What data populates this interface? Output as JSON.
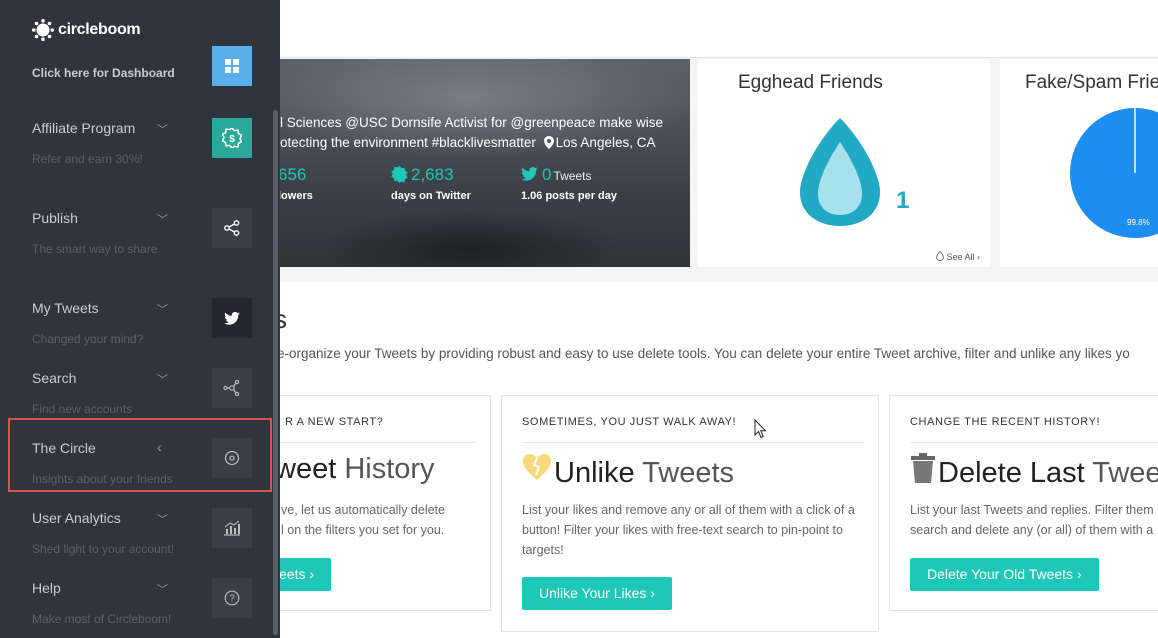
{
  "brand": {
    "name": "circleboom"
  },
  "sidebar": {
    "dashboard_label": "Click here for Dashboard",
    "items": [
      {
        "label": "Affiliate Program",
        "sub": "Refer and earn 30%!",
        "icon": "dollar-icon"
      },
      {
        "label": "Publish",
        "sub": "The smart way to share",
        "icon": "share-icon"
      },
      {
        "label": "My Tweets",
        "sub": "Changed your mind?",
        "icon": "twitter-icon"
      },
      {
        "label": "Search",
        "sub": "Find new accounts",
        "icon": "network-icon"
      },
      {
        "label": "The Circle",
        "sub": "Insights about your friends",
        "icon": "circle-icon"
      },
      {
        "label": "User Analytics",
        "sub": "Shed light to your account!",
        "icon": "chart-icon"
      },
      {
        "label": "Help",
        "sub": "Make most of Circleboom!",
        "icon": "question-icon"
      }
    ]
  },
  "profile": {
    "bio_line1": "l Sciences @USC Dornsife Activist for @greenpeace make wise",
    "bio_line2": "otecting the environment #blacklivesmatter",
    "location": "Los Angeles, CA",
    "stat_followers_value": "656",
    "stat_followers_label": "lowers",
    "stat_days_value": "2,683",
    "stat_days_label": "days on Twitter",
    "stat_tweets_value": "0",
    "stat_tweets_unit": "Tweets",
    "stat_tweets_label": "1.06 posts per day"
  },
  "egghead": {
    "title": "Egghead Friends",
    "count": "1",
    "see_all": "See All"
  },
  "fakespam": {
    "title": "Fake/Spam Frien",
    "percent": "99.8%"
  },
  "section": {
    "title": "s",
    "description": "e-organize your Tweets by providing robust and easy to use delete tools. You can delete your entire Tweet archive, filter and unlike any likes yo"
  },
  "cards": [
    {
      "kicker": "R A NEW START?",
      "title_bold": "weet",
      "title_light": "History",
      "desc_line1": "ve, let us automatically delete",
      "desc_line2": "l on the filters you set for you.",
      "button": "eets"
    },
    {
      "kicker": "SOMETIMES, YOU JUST WALK AWAY!",
      "title_bold": "Unlike",
      "title_light": "Tweets",
      "desc": "List your likes and remove any or all of them with a click of a button! Filter your likes with free-text search to pin-point to targets!",
      "button": "Unlike Your Likes"
    },
    {
      "kicker": "CHANGE THE RECENT HISTORY!",
      "title_bold": "Delete Last",
      "title_light": "Tweet",
      "desc_line1": "List your last Tweets and replies. Filter them",
      "desc_line2": "search and delete any (or all) of them with a",
      "button": "Delete Your Old Tweets"
    }
  ],
  "colors": {
    "accent": "#1ec7b7",
    "sidebar_bg": "#2f353d",
    "highlight": "#d9534f",
    "egg": "#22a9c4",
    "pie": "#1d8ef0"
  }
}
